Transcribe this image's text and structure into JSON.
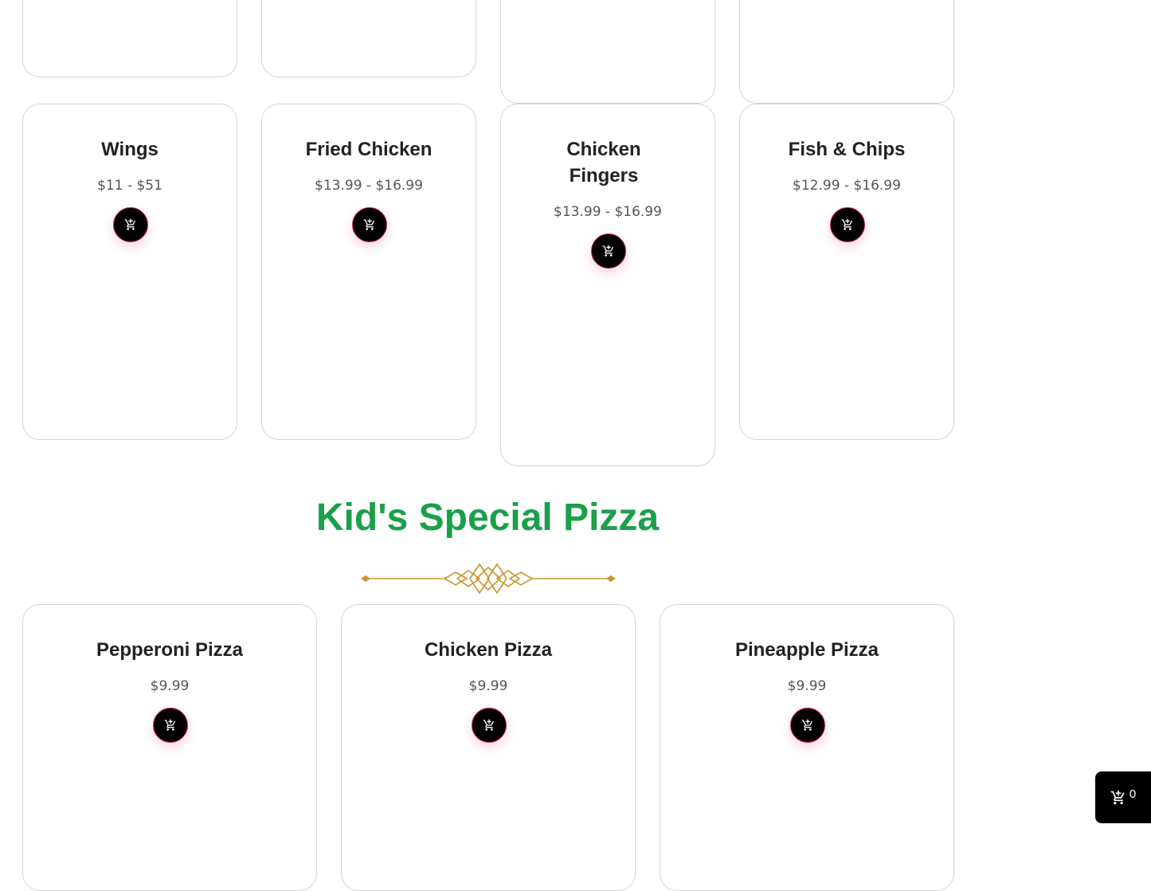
{
  "top_products": [
    {
      "name": "Wings",
      "price": "$11 - $51"
    },
    {
      "name": "Fried Chicken",
      "price": "$13.99 - $16.99"
    },
    {
      "name": "Chicken Fingers",
      "price": "$13.99 - $16.99"
    },
    {
      "name": "Fish & Chips",
      "price": "$12.99 - $16.99"
    }
  ],
  "section": {
    "title": "Kid's Special Pizza"
  },
  "pizza_products": [
    {
      "name": "Pepperoni Pizza",
      "price": "$9.99"
    },
    {
      "name": "Chicken Pizza",
      "price": "$9.99"
    },
    {
      "name": "Pineapple Pizza",
      "price": "$9.99"
    }
  ],
  "floating_cart": {
    "count": "0",
    "icon": "cart-plus-icon"
  },
  "colors": {
    "accent": "#1aa049",
    "divider": "#c8962e",
    "button_border": "#d21a5e"
  }
}
